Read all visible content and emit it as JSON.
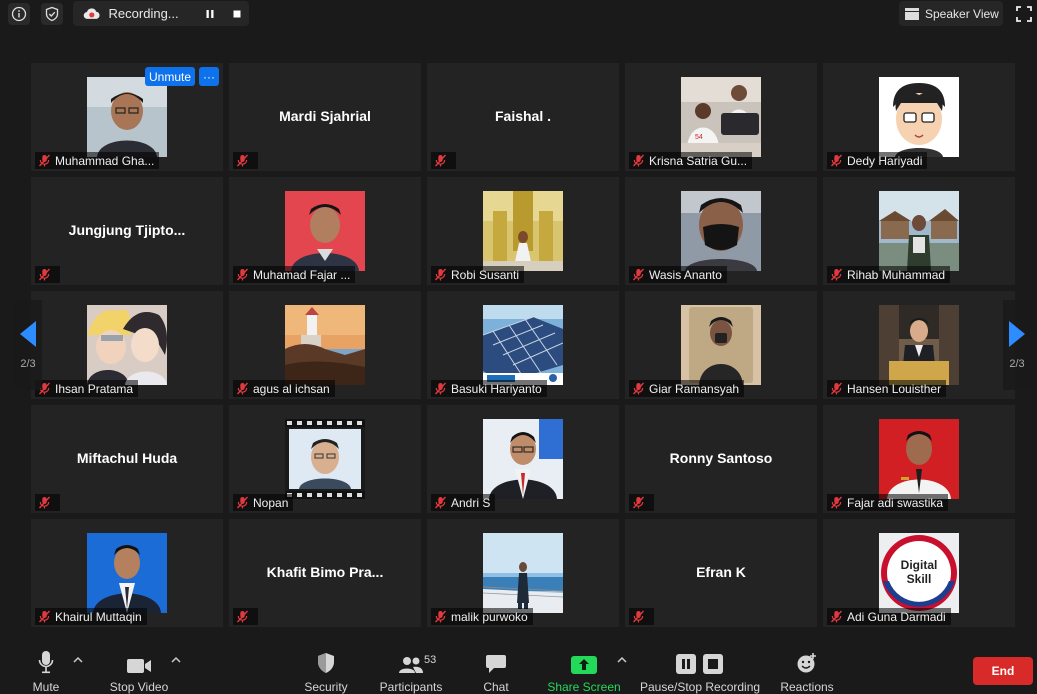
{
  "topbar": {
    "recording_label": "Recording...",
    "view_label": "Speaker View"
  },
  "tile_controls": {
    "unmute_label": "Unmute",
    "more_label": "···"
  },
  "participants": [
    {
      "name": "Muhammad Gha...",
      "display": "photo",
      "icon": "avatar-man-glasses"
    },
    {
      "name": "",
      "display": "name",
      "big_name": "Mardi Sjahrial"
    },
    {
      "name": "",
      "display": "name",
      "big_name": "Faishal ."
    },
    {
      "name": "Krisna Satria Gu...",
      "display": "photo",
      "icon": "avatar-group"
    },
    {
      "name": "Dedy Hariyadi",
      "display": "photo",
      "icon": "avatar-cartoon"
    },
    {
      "name": "",
      "display": "name",
      "big_name": "Jungjung  Tjipto..."
    },
    {
      "name": "Muhamad Fajar ...",
      "display": "photo",
      "icon": "avatar-man-red"
    },
    {
      "name": "Robi Susanti",
      "display": "photo",
      "icon": "avatar-temple"
    },
    {
      "name": "Wasis Ananto",
      "display": "photo",
      "icon": "avatar-mask"
    },
    {
      "name": "Rihab Muhammad",
      "display": "photo",
      "icon": "avatar-village"
    },
    {
      "name": "Ihsan Pratama",
      "display": "photo",
      "icon": "avatar-anime"
    },
    {
      "name": "agus al ichsan",
      "display": "photo",
      "icon": "avatar-lighthouse"
    },
    {
      "name": "Basuki Hariyanto",
      "display": "photo",
      "icon": "avatar-solar"
    },
    {
      "name": "Giar Ramansyah",
      "display": "photo",
      "icon": "avatar-mirror"
    },
    {
      "name": "Hansen Louisther",
      "display": "photo",
      "icon": "avatar-suit-event"
    },
    {
      "name": "",
      "display": "name",
      "big_name": "Miftachul Huda"
    },
    {
      "name": "Nopan",
      "display": "photo",
      "icon": "avatar-film"
    },
    {
      "name": "Andri S",
      "display": "photo",
      "icon": "avatar-suit-blue"
    },
    {
      "name": "",
      "display": "name",
      "big_name": "Ronny Santoso"
    },
    {
      "name": "Fajar adi swastika",
      "display": "photo",
      "icon": "avatar-red-bg"
    },
    {
      "name": "Khairul Muttaqin",
      "display": "photo",
      "icon": "avatar-blue-bg"
    },
    {
      "name": "",
      "display": "name",
      "big_name": "Khafit  Bimo Pra..."
    },
    {
      "name": "malik purwoko",
      "display": "photo",
      "icon": "avatar-ship"
    },
    {
      "name": "",
      "display": "name",
      "big_name": "Efran K"
    },
    {
      "name": "Adi Guna Darmadi",
      "display": "photo",
      "icon": "avatar-digital-skill",
      "logo_text": "Digital Skill"
    }
  ],
  "paging": {
    "left": "2/3",
    "right": "2/3"
  },
  "toolbar": {
    "mute": "Mute",
    "stop_video": "Stop Video",
    "security": "Security",
    "participants": "Participants",
    "participants_count": "53",
    "chat": "Chat",
    "share_screen": "Share Screen",
    "pause_recording": "Pause/Stop Recording",
    "reactions": "Reactions",
    "end": "End"
  },
  "colors": {
    "accent_blue": "#0e72ed",
    "share_green": "#23d959",
    "end_red": "#d92a2a",
    "muted_red": "#e0393e"
  }
}
